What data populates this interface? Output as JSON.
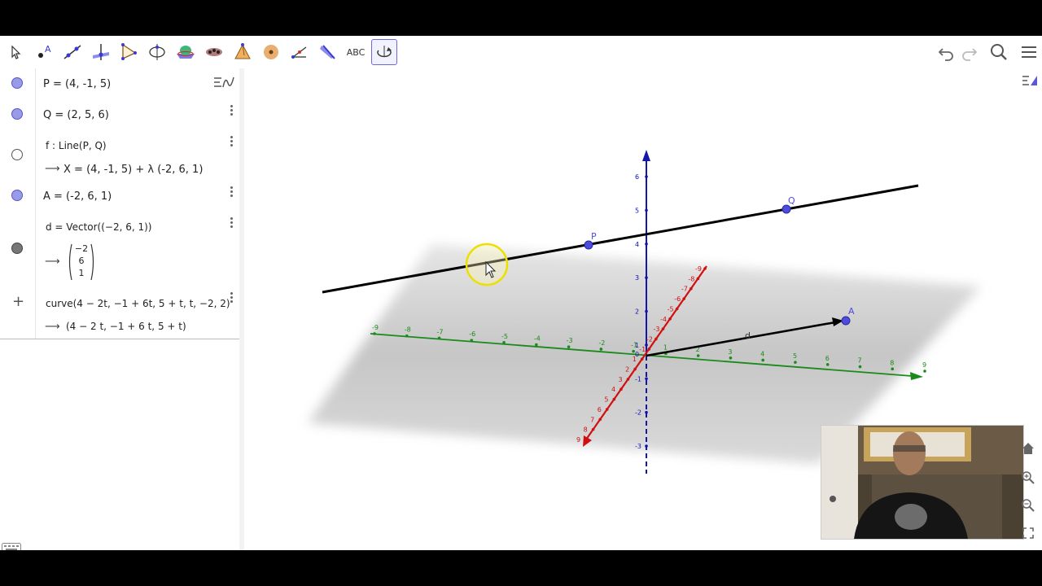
{
  "toolbar": {
    "tools": [
      "move",
      "point",
      "line",
      "perpendicular",
      "polygon",
      "circle",
      "intersect",
      "plane",
      "pyramid",
      "sphere",
      "angle",
      "reflect",
      "text",
      "rotate-view"
    ],
    "text_tool_label": "ABC",
    "active_tool": "rotate-view",
    "right": [
      "undo",
      "redo",
      "search",
      "menu"
    ]
  },
  "algebra": {
    "rows": [
      {
        "marble": "blue",
        "line1": "P = (4, -1, 5)"
      },
      {
        "marble": "blue",
        "line1": "Q = (2, 5, 6)"
      },
      {
        "marble": "empty",
        "line1": "f : Line(P, Q)",
        "line2": "X = (4, -1, 5) + λ (-2, 6, 1)"
      },
      {
        "marble": "blue",
        "line1": "A = (-2, 6, 1)"
      },
      {
        "marble": "gray",
        "line1": "d = Vector((−2, 6, 1))",
        "vector": [
          "−2",
          "6",
          "1"
        ]
      },
      {
        "marble": "plus",
        "line1": "curve(4 − 2t, −1 + 6t, 5 + t, t, −2, 2)",
        "line2": "(4 − 2 t, −1 + 6 t, 5 + t)"
      }
    ]
  },
  "graphics": {
    "points": {
      "P": "P",
      "Q": "Q",
      "A": "A"
    },
    "vector_label": "d",
    "x_ticks": [
      "9",
      "8",
      "7",
      "6",
      "5",
      "4",
      "3",
      "2",
      "1",
      "-1",
      "-2",
      "-3",
      "-4",
      "-5",
      "-6",
      "-7",
      "-8",
      "-9"
    ],
    "y_ticks": [
      "-9",
      "-8",
      "-7",
      "-6",
      "-5",
      "-4",
      "-3",
      "-2",
      "-1",
      "1",
      "2",
      "3",
      "4",
      "5",
      "6",
      "7",
      "8",
      "9"
    ],
    "z_ticks": [
      "6",
      "5",
      "4",
      "3",
      "2",
      "1",
      "-1",
      "-2",
      "-3"
    ],
    "origin_label": "0",
    "colors": {
      "x_axis": "#d01010",
      "y_axis": "#1a8a1a",
      "z_axis": "#1010b0",
      "point": "#4d4ddb",
      "line": "#000000",
      "highlight": "#f0e000"
    }
  },
  "webcam": {
    "label": "presenter webcam"
  }
}
